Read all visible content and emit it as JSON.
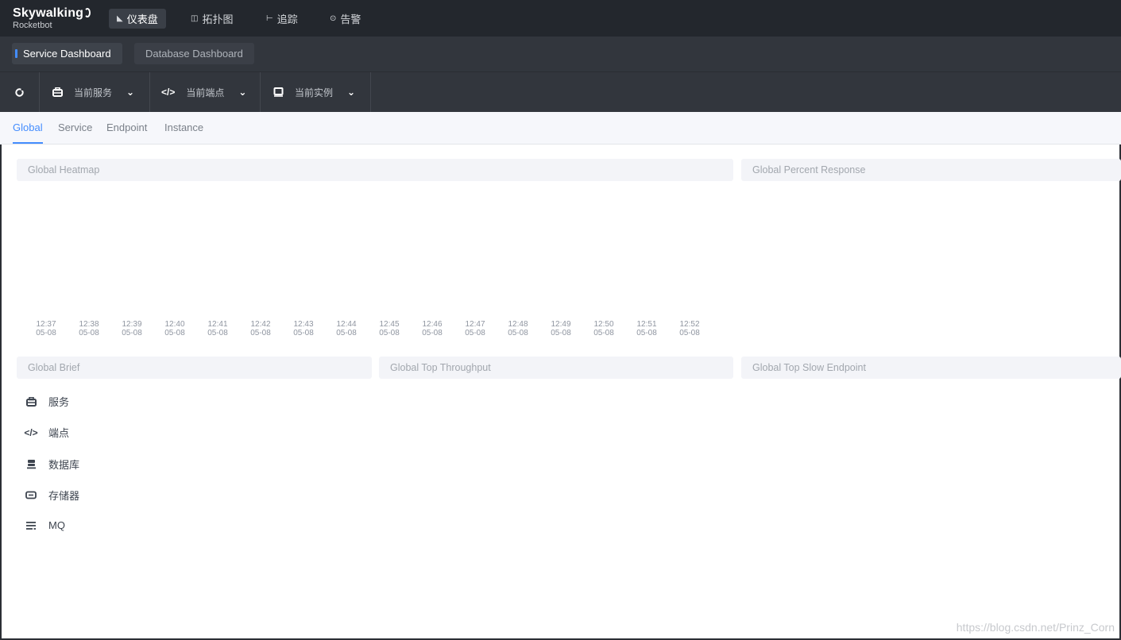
{
  "app": {
    "name": "Skywalking",
    "sub": "Rocketbot"
  },
  "topnav": [
    {
      "icon": "dashboard-icon",
      "glyph": "◣",
      "label": "仪表盘",
      "active": true
    },
    {
      "icon": "topology-icon",
      "glyph": "◫",
      "label": "拓扑图",
      "active": false
    },
    {
      "icon": "trace-icon",
      "glyph": "⊢",
      "label": "追踪",
      "active": false
    },
    {
      "icon": "alarm-icon",
      "glyph": "⊙",
      "label": "告警",
      "active": false
    }
  ],
  "dashboards": [
    {
      "label": "Service Dashboard",
      "active": true
    },
    {
      "label": "Database Dashboard",
      "active": false
    }
  ],
  "toolbar": {
    "refresh_icon": "refresh-icon",
    "selectors": [
      {
        "icon": "service-icon",
        "label": "当前服务"
      },
      {
        "icon": "endpoint-icon",
        "label": "当前端点"
      },
      {
        "icon": "instance-icon",
        "label": "当前实例"
      }
    ]
  },
  "subtabs": [
    {
      "label": "Global",
      "active": true
    },
    {
      "label": "Service",
      "active": false
    },
    {
      "label": "Endpoint",
      "active": false
    },
    {
      "label": "Instance",
      "active": false
    }
  ],
  "panels": {
    "heatmap": "Global Heatmap",
    "percent_response": "Global Percent Response",
    "brief": "Global Brief",
    "top_throughput": "Global Top Throughput",
    "top_slow": "Global Top Slow Endpoint"
  },
  "heatmap_axis": [
    {
      "time": "12:37",
      "date": "05-08"
    },
    {
      "time": "12:38",
      "date": "05-08"
    },
    {
      "time": "12:39",
      "date": "05-08"
    },
    {
      "time": "12:40",
      "date": "05-08"
    },
    {
      "time": "12:41",
      "date": "05-08"
    },
    {
      "time": "12:42",
      "date": "05-08"
    },
    {
      "time": "12:43",
      "date": "05-08"
    },
    {
      "time": "12:44",
      "date": "05-08"
    },
    {
      "time": "12:45",
      "date": "05-08"
    },
    {
      "time": "12:46",
      "date": "05-08"
    },
    {
      "time": "12:47",
      "date": "05-08"
    },
    {
      "time": "12:48",
      "date": "05-08"
    },
    {
      "time": "12:49",
      "date": "05-08"
    },
    {
      "time": "12:50",
      "date": "05-08"
    },
    {
      "time": "12:51",
      "date": "05-08"
    },
    {
      "time": "12:52",
      "date": "05-08"
    }
  ],
  "brief": [
    {
      "icon": "service-icon",
      "label": "服务"
    },
    {
      "icon": "endpoint-icon",
      "label": "端点"
    },
    {
      "icon": "database-icon",
      "label": "数据库"
    },
    {
      "icon": "storage-icon",
      "label": "存储器"
    },
    {
      "icon": "mq-icon",
      "label": "MQ"
    }
  ],
  "watermark": "https://blog.csdn.net/Prinz_Corn"
}
